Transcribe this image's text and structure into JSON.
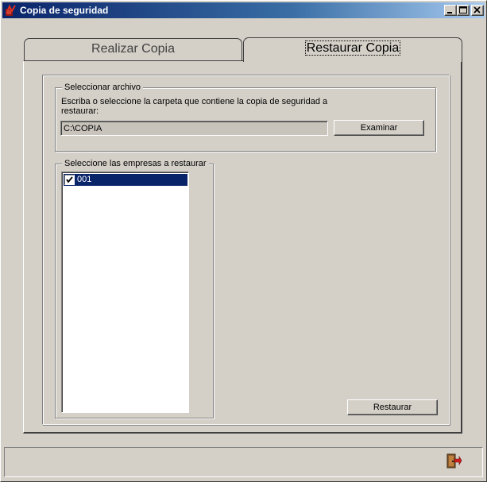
{
  "window": {
    "title": "Copia de seguridad",
    "controls": [
      "minimize",
      "maximize",
      "close"
    ]
  },
  "tabs": [
    {
      "label": "Realizar Copia",
      "active": false
    },
    {
      "label": "Restaurar Copia",
      "active": true
    }
  ],
  "select_file": {
    "group_label": "Seleccionar archivo",
    "instruction_line1": "Escriba o seleccione la carpeta que contiene la copia de seguridad a",
    "instruction_line2": "restaurar:",
    "path_value": "C:\\COPIA",
    "browse_label": "Examinar"
  },
  "companies": {
    "group_label": "Seleccione las empresas a restaurar",
    "items": [
      {
        "label": "001",
        "checked": true,
        "selected": true
      }
    ]
  },
  "actions": {
    "restore_label": "Restaurar"
  },
  "icons": {
    "app": "backup-app-icon",
    "exit": "exit-door-icon"
  },
  "colors": {
    "title_start": "#0a246a",
    "title_end": "#a6caf0",
    "face": "#d4d0c8",
    "selection": "#0a246a"
  }
}
